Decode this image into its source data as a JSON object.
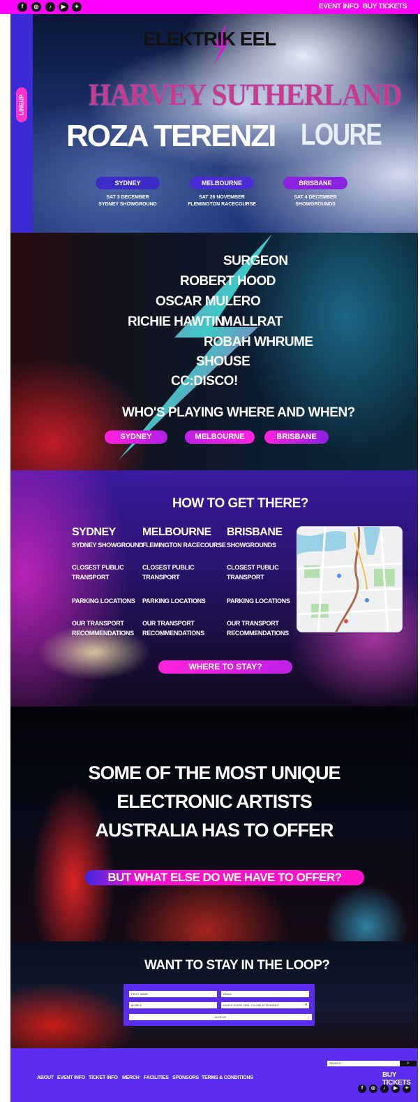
{
  "topbar": {
    "social": [
      "f",
      "◎",
      "♪",
      "▶",
      "✦"
    ],
    "event_info": "EVENT INFO",
    "buy_tickets": "BUY TICKETS"
  },
  "hero": {
    "logo": "ELEKTRIK EEL",
    "lineup_tab": "LINEUP",
    "headliners": [
      "HARVEY SUTHERLAND",
      "ROZA TERENZI",
      "LOURE"
    ],
    "cities": [
      {
        "name": "SYDNEY",
        "date": "SAT 3 DECEMBER",
        "venue": "SYDNEY SHOWGROUND"
      },
      {
        "name": "MELBOURNE",
        "date": "SAT 26 NOVEMBER",
        "venue": "FLEMINGTON RACECOURSE"
      },
      {
        "name": "BRISBANE",
        "date": "SAT 4 DECEMBER",
        "venue": "SHOWGROUNDS"
      }
    ]
  },
  "lineup": {
    "artists": [
      "SURGEON",
      "ROBERT HOOD",
      "OSCAR MULERO",
      "RICHIE HAWTIN",
      "MALLRAT",
      "ROBAH WHRUME",
      "SHOUSE",
      "CC:DISCO!"
    ],
    "who_title": "WHO'S PLAYING WHERE AND WHEN?",
    "pills": [
      "SYDNEY",
      "MELBOURNE",
      "BRISBANE"
    ]
  },
  "transport": {
    "title": "HOW TO GET THERE?",
    "columns": [
      {
        "city": "SYDNEY",
        "venue": "SYDNEY SHOWGROUND",
        "links": [
          "CLOSEST PUBLIC TRANSPORT",
          "PARKING LOCATIONS",
          "OUR TRANSPORT RECOMMENDATIONS"
        ]
      },
      {
        "city": "MELBOURNE",
        "venue": "FLEMINGTON RACECOURSE",
        "links": [
          "CLOSEST PUBLIC TRANSPORT",
          "PARKING LOCATIONS",
          "OUR TRANSPORT RECOMMENDATIONS"
        ]
      },
      {
        "city": "BRISBANE",
        "venue": "SHOWGROUNDS",
        "links": [
          "CLOSEST PUBLIC TRANSPORT",
          "PARKING LOCATIONS",
          "OUR TRANSPORT RECOMMENDATIONS"
        ]
      }
    ],
    "stay": "WHERE TO STAY?"
  },
  "unique": {
    "lines": [
      "SOME OF THE MOST UNIQUE",
      "ELECTRONIC ARTISTS",
      "AUSTRALIA HAS TO OFFER"
    ],
    "offer": "BUT WHAT ELSE DO WE HAVE TO OFFER?"
  },
  "loop": {
    "title": "WANT TO STAY IN THE LOOP?",
    "first_name": "FIRST NAME",
    "email": "EMAIL",
    "mobile": "MOBILE",
    "event_select": "WHICH EVENT WILL YOU BE ATTENDING?",
    "signup": "SIGN UP"
  },
  "footer": {
    "links": [
      "ABOUT",
      "EVENT INFO",
      "TICKET INFO",
      "MERCH",
      "FACILITIES",
      "SPONSORS",
      "TERMS & CONDITIONS"
    ],
    "search_placeholder": "SEARCH",
    "buy_tickets": "BUY TICKETS",
    "social": [
      "f",
      "◎",
      "♪",
      "▶",
      "✦"
    ]
  },
  "colors": {
    "magenta": "#ff00ff",
    "violet": "#5b2df0",
    "pill_purple": "#3d2bc8"
  }
}
